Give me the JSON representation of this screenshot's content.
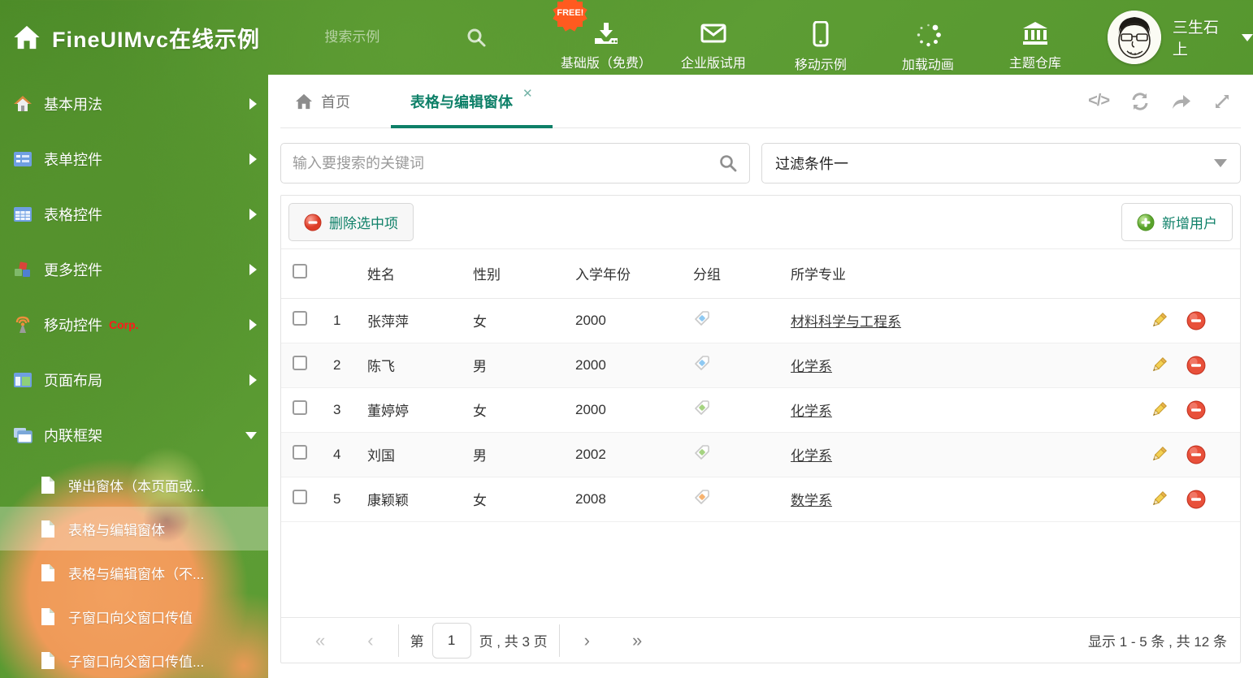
{
  "header": {
    "logo": "FineUIMvc在线示例",
    "search_placeholder": "搜索示例",
    "free_badge": "FREE!",
    "nav": [
      {
        "icon": "download-icon",
        "label": "基础版（免费）"
      },
      {
        "icon": "envelope-icon",
        "label": "企业版试用"
      },
      {
        "icon": "phone-icon",
        "label": "移动示例"
      },
      {
        "icon": "spinner-icon",
        "label": "加载动画"
      },
      {
        "icon": "bank-icon",
        "label": "主题仓库"
      }
    ],
    "username": "三生石上"
  },
  "sidebar": {
    "items": [
      {
        "label": "基本用法"
      },
      {
        "label": "表单控件"
      },
      {
        "label": "表格控件"
      },
      {
        "label": "更多控件"
      },
      {
        "label": "移动控件",
        "badge": "Corp."
      },
      {
        "label": "页面布局"
      },
      {
        "label": "内联框架",
        "expanded": true
      }
    ],
    "subitems": [
      {
        "label": "弹出窗体（本页面或..."
      },
      {
        "label": "表格与编辑窗体",
        "selected": true
      },
      {
        "label": "表格与编辑窗体（不..."
      },
      {
        "label": "子窗口向父窗口传值"
      },
      {
        "label": "子窗口向父窗口传值..."
      }
    ]
  },
  "tabs": {
    "home": {
      "label": "首页"
    },
    "active": {
      "label": "表格与编辑窗体",
      "close": "✕"
    }
  },
  "main": {
    "search_placeholder": "输入要搜索的关键词",
    "filter_value": "过滤条件一",
    "delete_button": "删除选中项",
    "add_button": "新增用户",
    "table": {
      "columns": {
        "name": "姓名",
        "gender": "性别",
        "year": "入学年份",
        "group": "分组",
        "major": "所学专业"
      },
      "rows": [
        {
          "num": "1",
          "name": "张萍萍",
          "gender": "女",
          "year": "2000",
          "tag_color": "#8ec9f2",
          "major": "材料科学与工程系"
        },
        {
          "num": "2",
          "name": "陈飞",
          "gender": "男",
          "year": "2000",
          "tag_color": "#8ec9f2",
          "major": "化学系"
        },
        {
          "num": "3",
          "name": "董婷婷",
          "gender": "女",
          "year": "2000",
          "tag_color": "#a5d381",
          "major": "化学系"
        },
        {
          "num": "4",
          "name": "刘国",
          "gender": "男",
          "year": "2002",
          "tag_color": "#a5d381",
          "major": "化学系"
        },
        {
          "num": "5",
          "name": "康颖颖",
          "gender": "女",
          "year": "2008",
          "tag_color": "#f6b26f",
          "major": "数学系"
        }
      ]
    },
    "pagination": {
      "first": "«",
      "prev": "‹",
      "next": "›",
      "last": "»",
      "page_prefix": "第",
      "page_value": "1",
      "page_suffix": "页 , 共 3 页",
      "summary": "显示 1 - 5 条 , 共 12 条"
    }
  },
  "colors": {
    "accent_teal": "#0e8068",
    "header_green": "#55932e",
    "free_badge_orange": "#ff5a1f",
    "delete_red": "#e3442e",
    "add_green": "#6cb52d"
  }
}
